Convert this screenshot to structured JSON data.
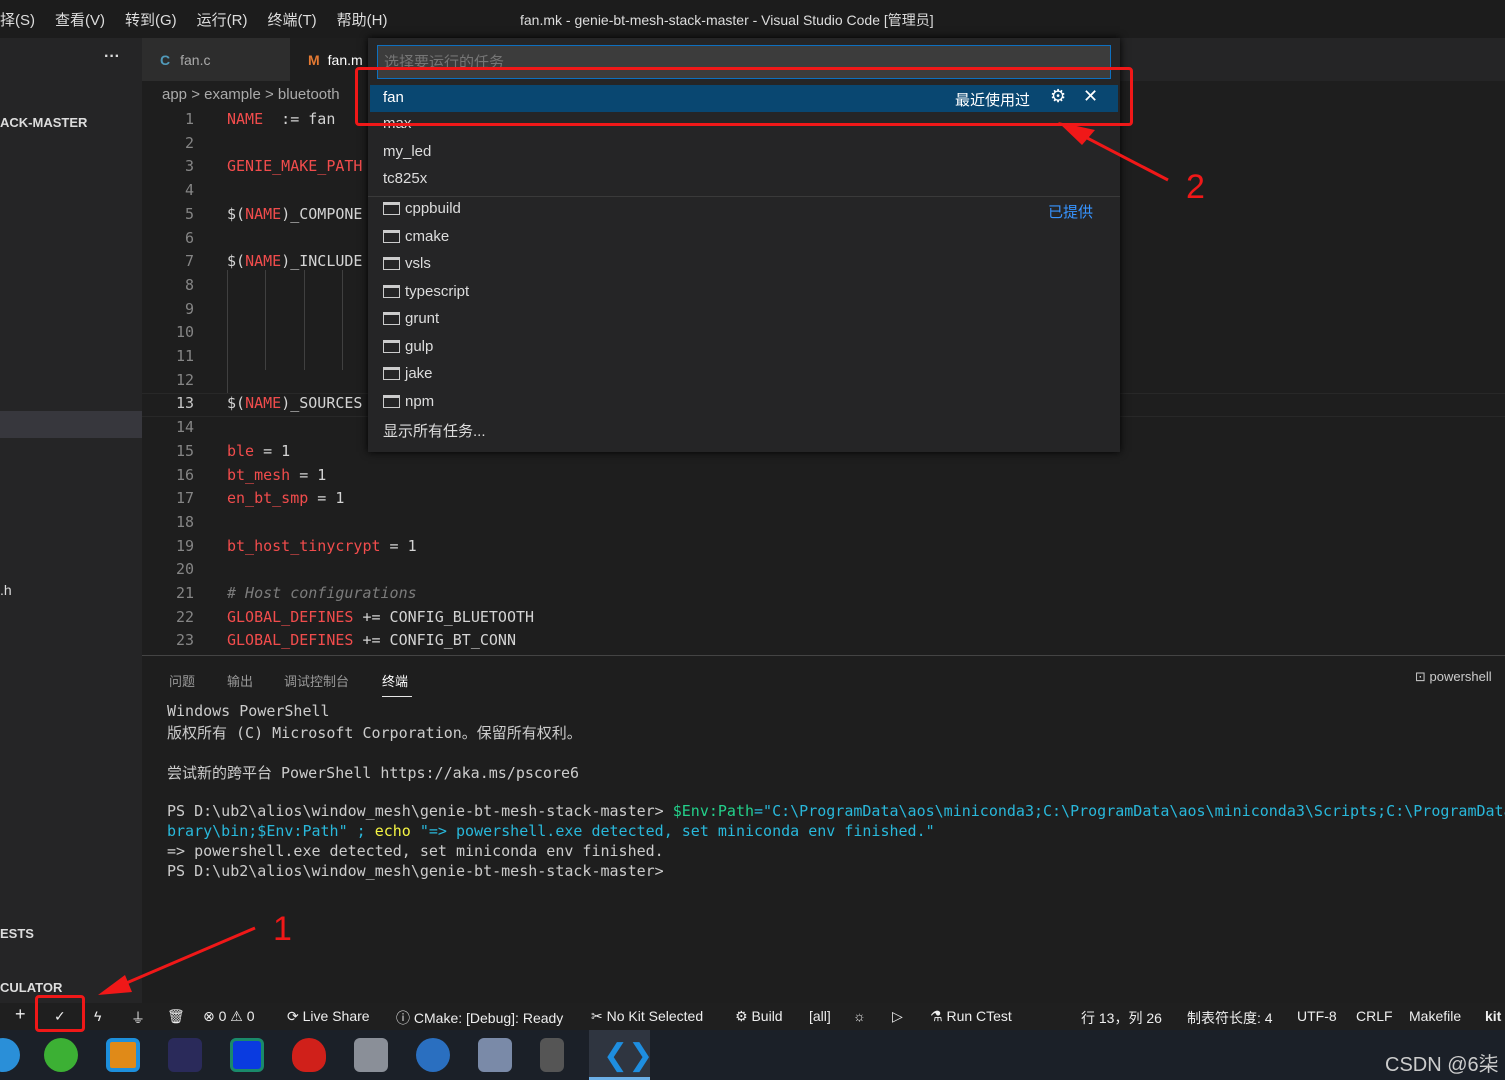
{
  "window": {
    "title": "fan.mk - genie-bt-mesh-stack-master - Visual Studio Code [管理员]"
  },
  "menu": [
    "择(S)",
    "查看(V)",
    "转到(G)",
    "运行(R)",
    "终端(T)",
    "帮助(H)"
  ],
  "sidebar": {
    "more": "···",
    "root": "ACK-MASTER",
    "file_h": ".h",
    "tests": "ESTS",
    "calculator": "CULATOR"
  },
  "tabs": [
    {
      "icon": "C",
      "label": "fan.c"
    },
    {
      "icon": "M",
      "label": "fan.m"
    }
  ],
  "breadcrumb": "app > example > bluetooth",
  "editor": {
    "lines": [
      {
        "n": "1",
        "parts": [
          [
            "kw",
            "NAME"
          ],
          [
            "",
            "  := fan"
          ]
        ]
      },
      {
        "n": "2",
        "parts": []
      },
      {
        "n": "3",
        "parts": [
          [
            "kw",
            "GENIE_MAKE_PATH"
          ]
        ]
      },
      {
        "n": "4",
        "parts": []
      },
      {
        "n": "5",
        "parts": [
          [
            "",
            "$("
          ],
          [
            "kw",
            "NAME"
          ],
          [
            "",
            ")_COMPONE"
          ]
        ]
      },
      {
        "n": "6",
        "parts": []
      },
      {
        "n": "7",
        "parts": [
          [
            "",
            "$("
          ],
          [
            "kw",
            "NAME"
          ],
          [
            "",
            ")_INCLUDE"
          ]
        ]
      },
      {
        "n": "8",
        "parts": []
      },
      {
        "n": "9",
        "parts": []
      },
      {
        "n": "10",
        "parts": []
      },
      {
        "n": "11",
        "parts": []
      },
      {
        "n": "12",
        "parts": []
      },
      {
        "n": "13",
        "parts": [
          [
            "",
            "$("
          ],
          [
            "kw",
            "NAME"
          ],
          [
            "",
            ")_SOURCES"
          ]
        ]
      },
      {
        "n": "14",
        "parts": []
      },
      {
        "n": "15",
        "parts": [
          [
            "kw",
            "ble"
          ],
          [
            "",
            " = 1"
          ]
        ]
      },
      {
        "n": "16",
        "parts": [
          [
            "kw",
            "bt_mesh"
          ],
          [
            "",
            " = 1"
          ]
        ]
      },
      {
        "n": "17",
        "parts": [
          [
            "kw",
            "en_bt_smp"
          ],
          [
            "",
            " = 1"
          ]
        ]
      },
      {
        "n": "18",
        "parts": []
      },
      {
        "n": "19",
        "parts": [
          [
            "kw",
            "bt_host_tinycrypt"
          ],
          [
            "",
            " = 1"
          ]
        ]
      },
      {
        "n": "20",
        "parts": []
      },
      {
        "n": "21",
        "parts": [
          [
            "cm",
            "# Host configurations"
          ]
        ]
      },
      {
        "n": "22",
        "parts": [
          [
            "kw",
            "GLOBAL_DEFINES"
          ],
          [
            "",
            " += CONFIG_BLUETOOTH"
          ]
        ]
      },
      {
        "n": "23",
        "parts": [
          [
            "kw",
            "GLOBAL_DEFINES"
          ],
          [
            "",
            " += CONFIG_BT_CONN"
          ]
        ]
      }
    ]
  },
  "quickpick": {
    "placeholder": "选择要运行的任务",
    "selected": "fan",
    "recent_label": "最近使用过",
    "provided_label": "已提供",
    "recent": [
      "max",
      "my_led",
      "tc825x"
    ],
    "folders": [
      "cppbuild",
      "cmake",
      "vsls",
      "typescript",
      "grunt",
      "gulp",
      "jake",
      "npm"
    ],
    "show_all": "显示所有任务..."
  },
  "panel": {
    "tabs": [
      "问题",
      "输出",
      "调试控制台",
      "终端"
    ],
    "active": "终端",
    "shell": "powershell",
    "lines": [
      "Windows PowerShell",
      "版权所有 (C) Microsoft Corporation。保留所有权利。",
      "",
      "尝试新的跨平台 PowerShell https://aka.ms/pscore6",
      "",
      "PS D:\\ub2\\alios\\window_mesh\\genie-bt-mesh-stack-master> ",
      "brary\\bin;$Env:Path\" ; ",
      "=> powershell.exe detected, set miniconda env finished.",
      "PS D:\\ub2\\alios\\window_mesh\\genie-bt-mesh-stack-master>"
    ],
    "cmd_var": "$Env:Path",
    "cmd_str": "=\"C:\\ProgramData\\aos\\miniconda3;C:\\ProgramData\\aos\\miniconda3\\Scripts;C:\\ProgramData",
    "cmd_echo": "echo",
    "cmd_msg": "\"=> powershell.exe detected, set miniconda env finished.\""
  },
  "status": {
    "errors": "0",
    "warnings": "0",
    "live_share": "Live Share",
    "cmake": "CMake: [Debug]: Ready",
    "kit": "No Kit Selected",
    "build": "Build",
    "target": "[all]",
    "ctest": "Run CTest",
    "position": "行 13，列 26",
    "tab_size": "制表符长度: 4",
    "encoding": "UTF-8",
    "eol": "CRLF",
    "language": "Makefile",
    "extra": "kit"
  },
  "annotations": {
    "one": "1",
    "two": "2",
    "accent": "#f01818"
  },
  "watermark": "CSDN @6柒"
}
